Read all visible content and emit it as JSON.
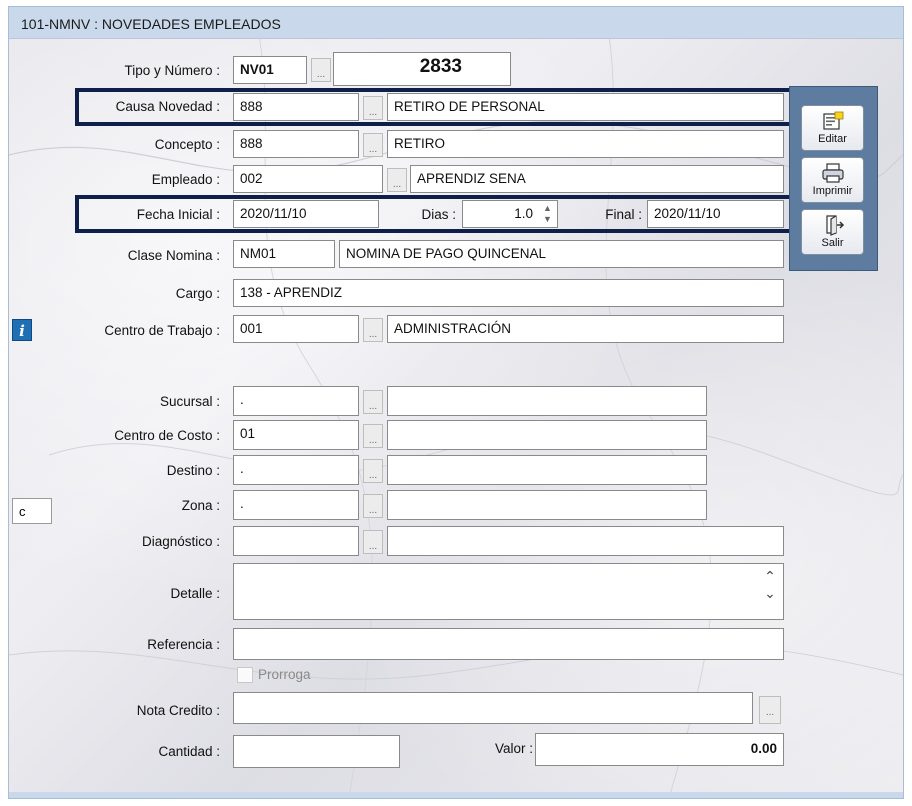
{
  "window": {
    "title": "101-NMNV : NOVEDADES EMPLEADOS"
  },
  "form": {
    "tipo_numero": {
      "label": "Tipo y Número :",
      "code": "NV01",
      "number": "2833"
    },
    "causa_novedad": {
      "label": "Causa Novedad :",
      "code": "888",
      "desc": "RETIRO DE PERSONAL"
    },
    "concepto": {
      "label": "Concepto :",
      "code": "888",
      "desc": "RETIRO"
    },
    "empleado": {
      "label": "Empleado :",
      "code": "002",
      "desc": "APRENDIZ SENA"
    },
    "fecha": {
      "label": "Fecha Inicial :",
      "inicial": "2020/11/10",
      "dias_label": "Dias :",
      "dias": "1.0",
      "final_label": "Final :",
      "final": "2020/11/10"
    },
    "clase_nomina": {
      "label": "Clase Nomina :",
      "code": "NM01",
      "desc": "NOMINA DE PAGO QUINCENAL"
    },
    "cargo": {
      "label": "Cargo :",
      "value": "138 - APRENDIZ"
    },
    "centro_trabajo": {
      "label": "Centro de Trabajo :",
      "code": "001",
      "desc": "ADMINISTRACIÓN"
    },
    "sucursal": {
      "label": "Sucursal :",
      "code": ".",
      "desc": ""
    },
    "centro_costo": {
      "label": "Centro de Costo :",
      "code": "01",
      "desc": ""
    },
    "destino": {
      "label": "Destino :",
      "code": ".",
      "desc": ""
    },
    "zona": {
      "label": "Zona :",
      "code": ".",
      "desc": ""
    },
    "diagnostico": {
      "label": "Diagnóstico :",
      "code": "",
      "desc": ""
    },
    "detalle": {
      "label": "Detalle :",
      "value": ""
    },
    "referencia": {
      "label": "Referencia :",
      "value": ""
    },
    "prorroga": {
      "label": "Prorroga"
    },
    "nota_credito": {
      "label": "Nota Credito :",
      "value": ""
    },
    "cantidad": {
      "label": "Cantidad :",
      "value": ""
    },
    "valor": {
      "label": "Valor :",
      "value": "0.00"
    },
    "lookup_glyph": "...",
    "side_box": "c"
  },
  "toolbar": {
    "editar": "Editar",
    "imprimir": "Imprimir",
    "salir": "Salir"
  },
  "icons": [
    "edit-icon",
    "printer-icon",
    "exit-icon",
    "info-icon"
  ],
  "colors": {
    "highlight": "#0e1f4a",
    "toolbar": "#5e7c9f",
    "titlebar": "#c9d8ea"
  }
}
